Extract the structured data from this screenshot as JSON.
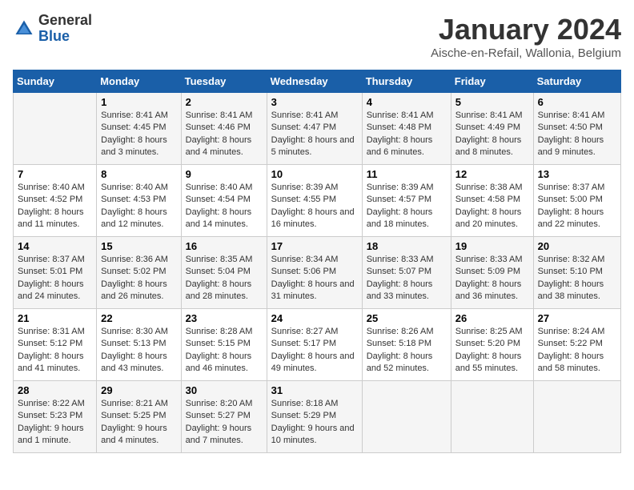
{
  "logo": {
    "general": "General",
    "blue": "Blue"
  },
  "header": {
    "month": "January 2024",
    "location": "Aische-en-Refail, Wallonia, Belgium"
  },
  "weekdays": [
    "Sunday",
    "Monday",
    "Tuesday",
    "Wednesday",
    "Thursday",
    "Friday",
    "Saturday"
  ],
  "weeks": [
    [
      {
        "day": "",
        "sunrise": "",
        "sunset": "",
        "daylight": ""
      },
      {
        "day": "1",
        "sunrise": "Sunrise: 8:41 AM",
        "sunset": "Sunset: 4:45 PM",
        "daylight": "Daylight: 8 hours and 3 minutes."
      },
      {
        "day": "2",
        "sunrise": "Sunrise: 8:41 AM",
        "sunset": "Sunset: 4:46 PM",
        "daylight": "Daylight: 8 hours and 4 minutes."
      },
      {
        "day": "3",
        "sunrise": "Sunrise: 8:41 AM",
        "sunset": "Sunset: 4:47 PM",
        "daylight": "Daylight: 8 hours and 5 minutes."
      },
      {
        "day": "4",
        "sunrise": "Sunrise: 8:41 AM",
        "sunset": "Sunset: 4:48 PM",
        "daylight": "Daylight: 8 hours and 6 minutes."
      },
      {
        "day": "5",
        "sunrise": "Sunrise: 8:41 AM",
        "sunset": "Sunset: 4:49 PM",
        "daylight": "Daylight: 8 hours and 8 minutes."
      },
      {
        "day": "6",
        "sunrise": "Sunrise: 8:41 AM",
        "sunset": "Sunset: 4:50 PM",
        "daylight": "Daylight: 8 hours and 9 minutes."
      }
    ],
    [
      {
        "day": "7",
        "sunrise": "Sunrise: 8:40 AM",
        "sunset": "Sunset: 4:52 PM",
        "daylight": "Daylight: 8 hours and 11 minutes."
      },
      {
        "day": "8",
        "sunrise": "Sunrise: 8:40 AM",
        "sunset": "Sunset: 4:53 PM",
        "daylight": "Daylight: 8 hours and 12 minutes."
      },
      {
        "day": "9",
        "sunrise": "Sunrise: 8:40 AM",
        "sunset": "Sunset: 4:54 PM",
        "daylight": "Daylight: 8 hours and 14 minutes."
      },
      {
        "day": "10",
        "sunrise": "Sunrise: 8:39 AM",
        "sunset": "Sunset: 4:55 PM",
        "daylight": "Daylight: 8 hours and 16 minutes."
      },
      {
        "day": "11",
        "sunrise": "Sunrise: 8:39 AM",
        "sunset": "Sunset: 4:57 PM",
        "daylight": "Daylight: 8 hours and 18 minutes."
      },
      {
        "day": "12",
        "sunrise": "Sunrise: 8:38 AM",
        "sunset": "Sunset: 4:58 PM",
        "daylight": "Daylight: 8 hours and 20 minutes."
      },
      {
        "day": "13",
        "sunrise": "Sunrise: 8:37 AM",
        "sunset": "Sunset: 5:00 PM",
        "daylight": "Daylight: 8 hours and 22 minutes."
      }
    ],
    [
      {
        "day": "14",
        "sunrise": "Sunrise: 8:37 AM",
        "sunset": "Sunset: 5:01 PM",
        "daylight": "Daylight: 8 hours and 24 minutes."
      },
      {
        "day": "15",
        "sunrise": "Sunrise: 8:36 AM",
        "sunset": "Sunset: 5:02 PM",
        "daylight": "Daylight: 8 hours and 26 minutes."
      },
      {
        "day": "16",
        "sunrise": "Sunrise: 8:35 AM",
        "sunset": "Sunset: 5:04 PM",
        "daylight": "Daylight: 8 hours and 28 minutes."
      },
      {
        "day": "17",
        "sunrise": "Sunrise: 8:34 AM",
        "sunset": "Sunset: 5:06 PM",
        "daylight": "Daylight: 8 hours and 31 minutes."
      },
      {
        "day": "18",
        "sunrise": "Sunrise: 8:33 AM",
        "sunset": "Sunset: 5:07 PM",
        "daylight": "Daylight: 8 hours and 33 minutes."
      },
      {
        "day": "19",
        "sunrise": "Sunrise: 8:33 AM",
        "sunset": "Sunset: 5:09 PM",
        "daylight": "Daylight: 8 hours and 36 minutes."
      },
      {
        "day": "20",
        "sunrise": "Sunrise: 8:32 AM",
        "sunset": "Sunset: 5:10 PM",
        "daylight": "Daylight: 8 hours and 38 minutes."
      }
    ],
    [
      {
        "day": "21",
        "sunrise": "Sunrise: 8:31 AM",
        "sunset": "Sunset: 5:12 PM",
        "daylight": "Daylight: 8 hours and 41 minutes."
      },
      {
        "day": "22",
        "sunrise": "Sunrise: 8:30 AM",
        "sunset": "Sunset: 5:13 PM",
        "daylight": "Daylight: 8 hours and 43 minutes."
      },
      {
        "day": "23",
        "sunrise": "Sunrise: 8:28 AM",
        "sunset": "Sunset: 5:15 PM",
        "daylight": "Daylight: 8 hours and 46 minutes."
      },
      {
        "day": "24",
        "sunrise": "Sunrise: 8:27 AM",
        "sunset": "Sunset: 5:17 PM",
        "daylight": "Daylight: 8 hours and 49 minutes."
      },
      {
        "day": "25",
        "sunrise": "Sunrise: 8:26 AM",
        "sunset": "Sunset: 5:18 PM",
        "daylight": "Daylight: 8 hours and 52 minutes."
      },
      {
        "day": "26",
        "sunrise": "Sunrise: 8:25 AM",
        "sunset": "Sunset: 5:20 PM",
        "daylight": "Daylight: 8 hours and 55 minutes."
      },
      {
        "day": "27",
        "sunrise": "Sunrise: 8:24 AM",
        "sunset": "Sunset: 5:22 PM",
        "daylight": "Daylight: 8 hours and 58 minutes."
      }
    ],
    [
      {
        "day": "28",
        "sunrise": "Sunrise: 8:22 AM",
        "sunset": "Sunset: 5:23 PM",
        "daylight": "Daylight: 9 hours and 1 minute."
      },
      {
        "day": "29",
        "sunrise": "Sunrise: 8:21 AM",
        "sunset": "Sunset: 5:25 PM",
        "daylight": "Daylight: 9 hours and 4 minutes."
      },
      {
        "day": "30",
        "sunrise": "Sunrise: 8:20 AM",
        "sunset": "Sunset: 5:27 PM",
        "daylight": "Daylight: 9 hours and 7 minutes."
      },
      {
        "day": "31",
        "sunrise": "Sunrise: 8:18 AM",
        "sunset": "Sunset: 5:29 PM",
        "daylight": "Daylight: 9 hours and 10 minutes."
      },
      {
        "day": "",
        "sunrise": "",
        "sunset": "",
        "daylight": ""
      },
      {
        "day": "",
        "sunrise": "",
        "sunset": "",
        "daylight": ""
      },
      {
        "day": "",
        "sunrise": "",
        "sunset": "",
        "daylight": ""
      }
    ]
  ]
}
